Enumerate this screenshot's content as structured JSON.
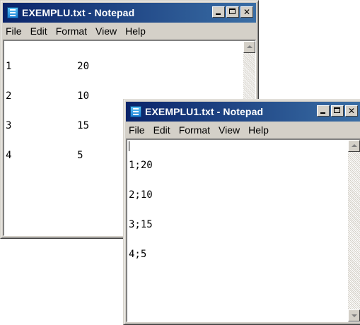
{
  "window1": {
    "title": "EXEMPLU.txt - Notepad",
    "menu": {
      "file": "File",
      "edit": "Edit",
      "format": "Format",
      "view": "View",
      "help": "Help"
    },
    "content_lines": [
      "1           20",
      "2           10",
      "3           15",
      "4           5"
    ]
  },
  "window2": {
    "title": "EXEMPLU1.txt - Notepad",
    "menu": {
      "file": "File",
      "edit": "Edit",
      "format": "Format",
      "view": "View",
      "help": "Help"
    },
    "content_lines": [
      "1;20",
      "2;10",
      "3;15",
      "4;5"
    ]
  },
  "icons": {
    "app": "notepad-icon",
    "minimize": "minimize-icon",
    "maximize": "maximize-icon",
    "close": "close-icon"
  },
  "colors": {
    "title_active": "#0a246a",
    "window_face": "#d4d0c8",
    "editor_bg": "#ffffff"
  }
}
